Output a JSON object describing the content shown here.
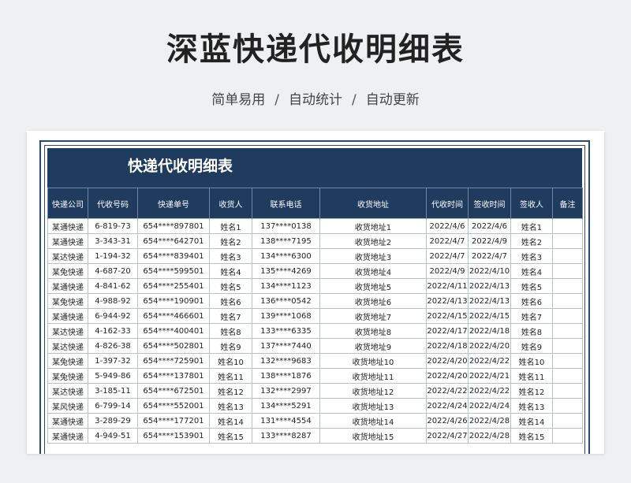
{
  "page": {
    "title": "深蓝快递代收明细表",
    "subtitle_parts": [
      "简单易用",
      "自动统计",
      "自动更新"
    ],
    "separator": "/"
  },
  "sheet": {
    "title": "快递代收明细表",
    "headers": [
      "快递公司",
      "代收号码",
      "快递单号",
      "收货人",
      "联系电话",
      "收货地址",
      "代收时间",
      "签收时间",
      "签收人",
      "备注"
    ],
    "rows": [
      [
        "某通快递",
        "6-819-73",
        "654****897801",
        "姓名1",
        "137****0138",
        "收货地址1",
        "2022/4/6",
        "2022/4/6",
        "姓名1",
        ""
      ],
      [
        "某通快递",
        "3-343-31",
        "654****642701",
        "姓名2",
        "138****7195",
        "收货地址2",
        "2022/4/7",
        "2022/4/9",
        "姓名2",
        ""
      ],
      [
        "某达快递",
        "1-194-32",
        "654****839401",
        "姓名3",
        "134****6300",
        "收货地址3",
        "2022/4/7",
        "2022/4/7",
        "姓名3",
        ""
      ],
      [
        "某兔快递",
        "4-687-20",
        "654****599501",
        "姓名4",
        "135****4269",
        "收货地址4",
        "2022/4/9",
        "2022/4/10",
        "姓名4",
        ""
      ],
      [
        "某通快递",
        "4-841-62",
        "654****255401",
        "姓名5",
        "134****1123",
        "收货地址5",
        "2022/4/11",
        "2022/4/13",
        "姓名5",
        ""
      ],
      [
        "某兔快递",
        "4-988-92",
        "654****190901",
        "姓名6",
        "136****0542",
        "收货地址6",
        "2022/4/13",
        "2022/4/13",
        "姓名6",
        ""
      ],
      [
        "某通快递",
        "6-944-92",
        "654****466601",
        "姓名7",
        "139****1068",
        "收货地址7",
        "2022/4/15",
        "2022/4/15",
        "姓名7",
        ""
      ],
      [
        "某达快递",
        "4-162-33",
        "654****400401",
        "姓名8",
        "133****6335",
        "收货地址8",
        "2022/4/17",
        "2022/4/18",
        "姓名8",
        ""
      ],
      [
        "某达快递",
        "4-826-38",
        "654****502801",
        "姓名9",
        "137****7440",
        "收货地址9",
        "2022/4/18",
        "2022/4/20",
        "姓名9",
        ""
      ],
      [
        "某兔快递",
        "1-397-32",
        "654****725901",
        "姓名10",
        "132****9683",
        "收货地址10",
        "2022/4/20",
        "2022/4/22",
        "姓名10",
        ""
      ],
      [
        "某兔快递",
        "5-949-86",
        "654****137801",
        "姓名11",
        "138****1876",
        "收货地址11",
        "2022/4/20",
        "2022/4/21",
        "姓名11",
        ""
      ],
      [
        "某达快递",
        "3-185-11",
        "654****672501",
        "姓名12",
        "132****2997",
        "收货地址12",
        "2022/4/22",
        "2022/4/22",
        "姓名12",
        ""
      ],
      [
        "某风快递",
        "6-799-14",
        "654****552001",
        "姓名13",
        "134****5291",
        "收货地址13",
        "2022/4/24",
        "2022/4/24",
        "姓名13",
        ""
      ],
      [
        "某通快递",
        "3-289-29",
        "654****177201",
        "姓名14",
        "131****4554",
        "收货地址14",
        "2022/4/26",
        "2022/4/28",
        "姓名14",
        ""
      ],
      [
        "某通快递",
        "4-949-51",
        "654****153901",
        "姓名15",
        "133****8287",
        "收货地址15",
        "2022/4/27",
        "2022/4/28",
        "姓名15",
        ""
      ]
    ]
  }
}
